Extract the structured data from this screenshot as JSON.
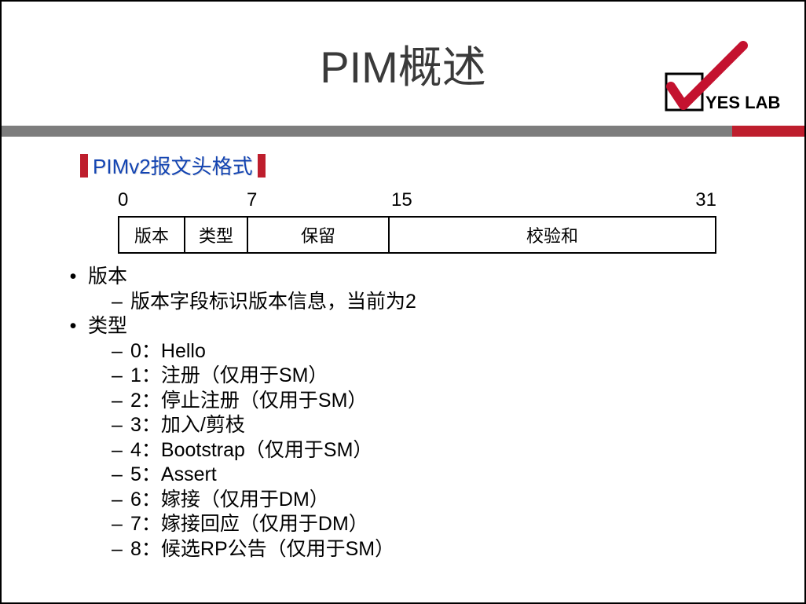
{
  "title": "PIM概述",
  "logo_text": "YES LAB",
  "subtitle": "PIMv2报文头格式",
  "bits": {
    "b0": "0",
    "b7": "7",
    "b15": "15",
    "b31": "31"
  },
  "fields": {
    "version": "版本",
    "type": "类型",
    "reserved": "保留",
    "checksum": "校验和"
  },
  "list": {
    "version_label": "版本",
    "version_desc": "版本字段标识版本信息，当前为2",
    "type_label": "类型",
    "types": [
      "0：Hello",
      "1：注册（仅用于SM）",
      "2：停止注册（仅用于SM）",
      "3：加入/剪枝",
      "4：Bootstrap（仅用于SM）",
      "5：Assert",
      "6：嫁接（仅用于DM）",
      "7：嫁接回应（仅用于DM）",
      "8：候选RP公告（仅用于SM）"
    ]
  }
}
